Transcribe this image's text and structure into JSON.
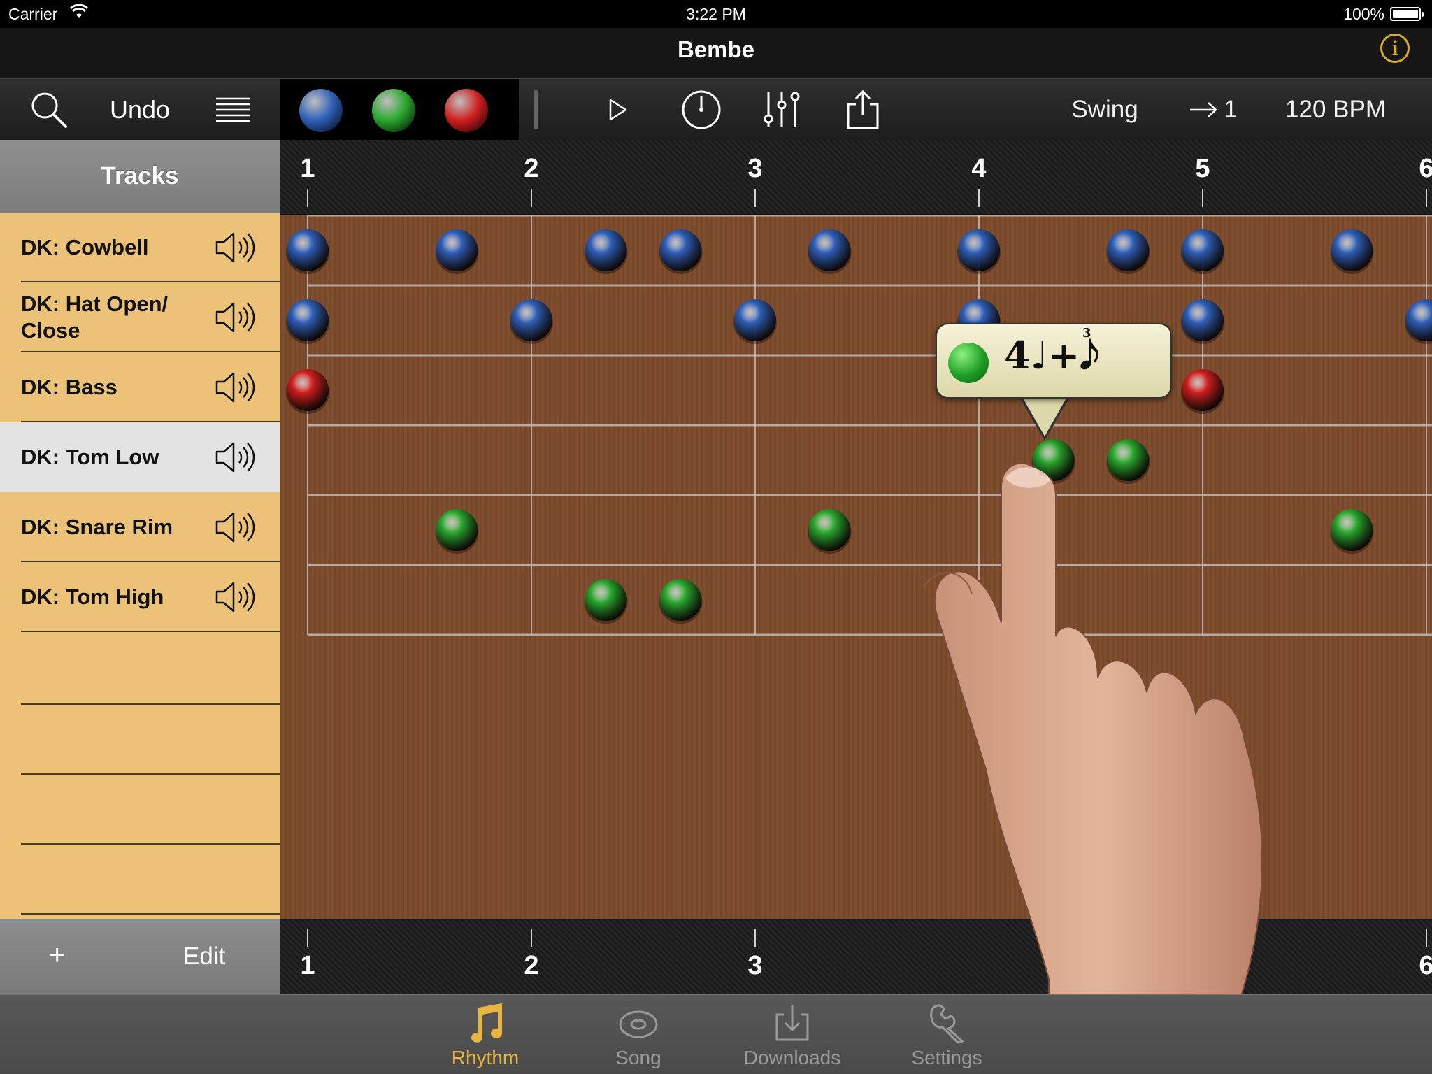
{
  "status_bar": {
    "carrier": "Carrier",
    "time": "3:22 PM",
    "battery": "100%"
  },
  "nav": {
    "title": "Bembe",
    "info_icon": "i"
  },
  "toolbar": {
    "search_icon": "search-icon",
    "undo_label": "Undo",
    "menu_icon": "list-icon",
    "swatch_colors": [
      "#2f5fb8",
      "#2aa82e",
      "#d11f1f"
    ],
    "play_icon": "play-icon",
    "clock_icon": "metronome-clock-icon",
    "mixer_icon": "mixer-sliders-icon",
    "share_icon": "share-icon",
    "swing_label": "Swing",
    "step_label": "1",
    "bpm_label": "120 BPM"
  },
  "sidebar": {
    "header": "Tracks",
    "tracks": [
      {
        "label": "DK: Cowbell",
        "selected": false
      },
      {
        "label": "DK: Hat Open/ Close",
        "selected": false
      },
      {
        "label": "DK: Bass",
        "selected": false
      },
      {
        "label": "DK: Tom Low",
        "selected": true
      },
      {
        "label": "DK: Snare Rim",
        "selected": false
      },
      {
        "label": "DK: Tom High",
        "selected": false
      }
    ],
    "add_label": "+",
    "edit_label": "Edit"
  },
  "grid": {
    "beats_top": [
      "1",
      "2",
      "3",
      "4",
      "5",
      "6"
    ],
    "beats_bottom": [
      "1",
      "2",
      "3",
      "6"
    ],
    "note_colors": {
      "blue": "#2f5fb8",
      "green": "#2aa82e",
      "red": "#d11f1f"
    },
    "notes": [
      {
        "track": 0,
        "pos": 0,
        "color": "blue"
      },
      {
        "track": 0,
        "pos": 0.667,
        "color": "blue"
      },
      {
        "track": 0,
        "pos": 1.333,
        "color": "blue"
      },
      {
        "track": 0,
        "pos": 1.667,
        "color": "blue"
      },
      {
        "track": 0,
        "pos": 2.333,
        "color": "blue"
      },
      {
        "track": 0,
        "pos": 3,
        "color": "blue"
      },
      {
        "track": 0,
        "pos": 3.667,
        "color": "blue"
      },
      {
        "track": 0,
        "pos": 4,
        "color": "blue"
      },
      {
        "track": 0,
        "pos": 4.667,
        "color": "blue"
      },
      {
        "track": 1,
        "pos": 0,
        "color": "blue"
      },
      {
        "track": 1,
        "pos": 1,
        "color": "blue"
      },
      {
        "track": 1,
        "pos": 2,
        "color": "blue"
      },
      {
        "track": 1,
        "pos": 3,
        "color": "blue"
      },
      {
        "track": 1,
        "pos": 4,
        "color": "blue"
      },
      {
        "track": 1,
        "pos": 5,
        "color": "blue"
      },
      {
        "track": 2,
        "pos": 0,
        "color": "red"
      },
      {
        "track": 2,
        "pos": 4,
        "color": "red"
      },
      {
        "track": 3,
        "pos": 3.333,
        "color": "green"
      },
      {
        "track": 3,
        "pos": 3.667,
        "color": "green"
      },
      {
        "track": 4,
        "pos": 0.667,
        "color": "green"
      },
      {
        "track": 4,
        "pos": 2.333,
        "color": "green"
      },
      {
        "track": 4,
        "pos": 4.667,
        "color": "green"
      },
      {
        "track": 5,
        "pos": 1.333,
        "color": "green"
      },
      {
        "track": 5,
        "pos": 1.667,
        "color": "green"
      }
    ]
  },
  "popup": {
    "notation": "4♩+𝅘𝅥𝅮",
    "triplet_mark": "3"
  },
  "tabs": [
    {
      "label": "Rhythm",
      "icon": "music-note-icon",
      "active": true
    },
    {
      "label": "Song",
      "icon": "disc-icon",
      "active": false
    },
    {
      "label": "Downloads",
      "icon": "download-tray-icon",
      "active": false
    },
    {
      "label": "Settings",
      "icon": "wrench-icon",
      "active": false
    }
  ]
}
